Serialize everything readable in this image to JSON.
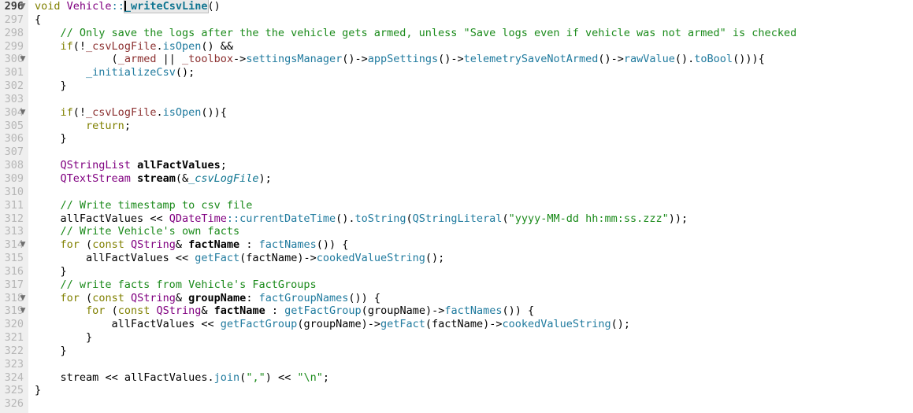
{
  "editor": {
    "language": "C++",
    "first_visible_line": 296,
    "current_line": 296,
    "cursor_symbol": "_writeCsvLine",
    "gutter_color": "#efefef",
    "background_color": "#ffffff",
    "colors": {
      "keyword": "#808000",
      "type": "#800080",
      "function_declaration": "#0e7490",
      "function_call": "#1f7a9e",
      "member_variable": "#8b2f2f",
      "string": "#1a8a1a",
      "comment": "#1a8a1a",
      "line_number": "#b6b6b6",
      "current_line_number": "#3b3b3b"
    }
  },
  "lines": [
    {
      "number": "296",
      "fold": "▼",
      "current": true,
      "text": "void Vehicle::_writeCsvLine()"
    },
    {
      "number": "297",
      "fold": "",
      "current": false,
      "text": "{"
    },
    {
      "number": "298",
      "fold": "",
      "current": false,
      "text": "    // Only save the logs after the the vehicle gets armed, unless \"Save logs even if vehicle was not armed\" is checked"
    },
    {
      "number": "299",
      "fold": "",
      "current": false,
      "text": "    if(!_csvLogFile.isOpen() &&"
    },
    {
      "number": "300",
      "fold": "▼",
      "current": false,
      "text": "            (_armed || _toolbox->settingsManager()->appSettings()->telemetrySaveNotArmed()->rawValue().toBool())){"
    },
    {
      "number": "301",
      "fold": "",
      "current": false,
      "text": "        _initializeCsv();"
    },
    {
      "number": "302",
      "fold": "",
      "current": false,
      "text": "    }"
    },
    {
      "number": "303",
      "fold": "",
      "current": false,
      "text": ""
    },
    {
      "number": "304",
      "fold": "▼",
      "current": false,
      "text": "    if(!_csvLogFile.isOpen()){"
    },
    {
      "number": "305",
      "fold": "",
      "current": false,
      "text": "        return;"
    },
    {
      "number": "306",
      "fold": "",
      "current": false,
      "text": "    }"
    },
    {
      "number": "307",
      "fold": "",
      "current": false,
      "text": ""
    },
    {
      "number": "308",
      "fold": "",
      "current": false,
      "text": "    QStringList allFactValues;"
    },
    {
      "number": "309",
      "fold": "",
      "current": false,
      "text": "    QTextStream stream(&_csvLogFile);"
    },
    {
      "number": "310",
      "fold": "",
      "current": false,
      "text": ""
    },
    {
      "number": "311",
      "fold": "",
      "current": false,
      "text": "    // Write timestamp to csv file"
    },
    {
      "number": "312",
      "fold": "",
      "current": false,
      "text": "    allFactValues << QDateTime::currentDateTime().toString(QStringLiteral(\"yyyy-MM-dd hh:mm:ss.zzz\"));"
    },
    {
      "number": "313",
      "fold": "",
      "current": false,
      "text": "    // Write Vehicle's own facts"
    },
    {
      "number": "314",
      "fold": "▼",
      "current": false,
      "text": "    for (const QString& factName : factNames()) {"
    },
    {
      "number": "315",
      "fold": "",
      "current": false,
      "text": "        allFactValues << getFact(factName)->cookedValueString();"
    },
    {
      "number": "316",
      "fold": "",
      "current": false,
      "text": "    }"
    },
    {
      "number": "317",
      "fold": "",
      "current": false,
      "text": "    // write facts from Vehicle's FactGroups"
    },
    {
      "number": "318",
      "fold": "▼",
      "current": false,
      "text": "    for (const QString& groupName: factGroupNames()) {"
    },
    {
      "number": "319",
      "fold": "▼",
      "current": false,
      "text": "        for (const QString& factName : getFactGroup(groupName)->factNames()) {"
    },
    {
      "number": "320",
      "fold": "",
      "current": false,
      "text": "            allFactValues << getFactGroup(groupName)->getFact(factName)->cookedValueString();"
    },
    {
      "number": "321",
      "fold": "",
      "current": false,
      "text": "        }"
    },
    {
      "number": "322",
      "fold": "",
      "current": false,
      "text": "    }"
    },
    {
      "number": "323",
      "fold": "",
      "current": false,
      "text": ""
    },
    {
      "number": "324",
      "fold": "",
      "current": false,
      "text": "    stream << allFactValues.join(\",\") << \"\\n\";"
    },
    {
      "number": "325",
      "fold": "",
      "current": false,
      "text": "}"
    },
    {
      "number": "326",
      "fold": "",
      "current": false,
      "text": ""
    }
  ]
}
